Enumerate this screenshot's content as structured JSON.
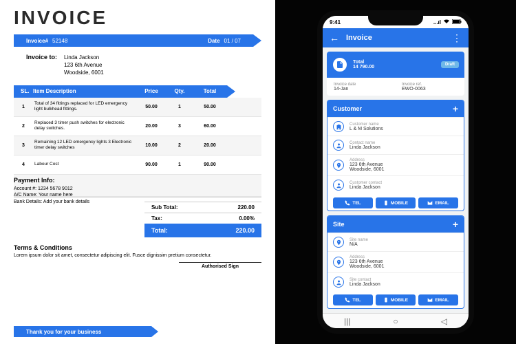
{
  "doc": {
    "title": "INVOICE",
    "invoice_label": "Invoice#",
    "invoice_no": "52148",
    "date_label": "Date",
    "date_value": "01 / 07",
    "to_label": "Invoice to:",
    "to_name": "Linda Jackson",
    "to_addr1": "123 6th Avenue",
    "to_addr2": "Woodside, 6001",
    "th": {
      "sl": "SL.",
      "desc": "Item Description",
      "price": "Price",
      "qty": "Qty.",
      "total": "Total"
    },
    "rows": [
      {
        "sl": "1",
        "desc": "Total of 34 fittings replaced for LED emergency light bulkhead fittings.",
        "price": "50.00",
        "qty": "1",
        "total": "50.00"
      },
      {
        "sl": "2",
        "desc": "Replaced 3 timer push switches for electronic delay switches.",
        "price": "20.00",
        "qty": "3",
        "total": "60.00"
      },
      {
        "sl": "3",
        "desc": "Remaining 12 LED emergency lights\n3 Electronic timer delay switches",
        "price": "10.00",
        "qty": "2",
        "total": "20.00"
      },
      {
        "sl": "4",
        "desc": "Labour Cost",
        "price": "90.00",
        "qty": "1",
        "total": "90.00"
      }
    ],
    "subtotal_label": "Sub Total:",
    "subtotal": "220.00",
    "tax_label": "Tax:",
    "tax": "0.00%",
    "total_label": "Total:",
    "total": "220.00",
    "pay_h": "Payment Info:",
    "pay_acct": "Account #:   1234 5678 9012",
    "pay_name": "A/C Name:   Your name here",
    "pay_bank": "Bank Details:   Add your bank details",
    "terms_h": "Terms & Conditions",
    "terms_t": "Lorem ipsum dolor sit amet, consectetur adipiscing elit. Fusce dignissim pretium consectetur.",
    "sign": "Authorised Sign",
    "thanks": "Thank you for your business"
  },
  "app": {
    "time": "9:41",
    "title": "Invoice",
    "sum_label": "Total",
    "sum_amount": "14 790.00",
    "draft": "Draft",
    "idate_l": "Invoice date",
    "idate_v": "14-Jan",
    "iref_l": "Invoice ref.",
    "iref_v": "EWO-0063",
    "customer_h": "Customer",
    "c_name_l": "Customer name",
    "c_name_v": "L & M Solutions",
    "c_contact_l": "Contact name",
    "c_contact_v": "Linda Jackson",
    "c_addr_l": "Address",
    "c_addr_v": "123 6th Avenue\nWoodside, 6001",
    "c_cc_l": "Customer contact",
    "c_cc_v": "Linda Jackson",
    "btn_tel": "TEL",
    "btn_mob": "MOBILE",
    "btn_email": "EMAIL",
    "site_h": "Site",
    "s_name_l": "Site name",
    "s_name_v": "N/A",
    "s_addr_l": "Address",
    "s_addr_v": "123 6th Avenue\nWoodside, 6001",
    "s_contact_l": "Site contact",
    "s_contact_v": "Linda Jackson"
  }
}
